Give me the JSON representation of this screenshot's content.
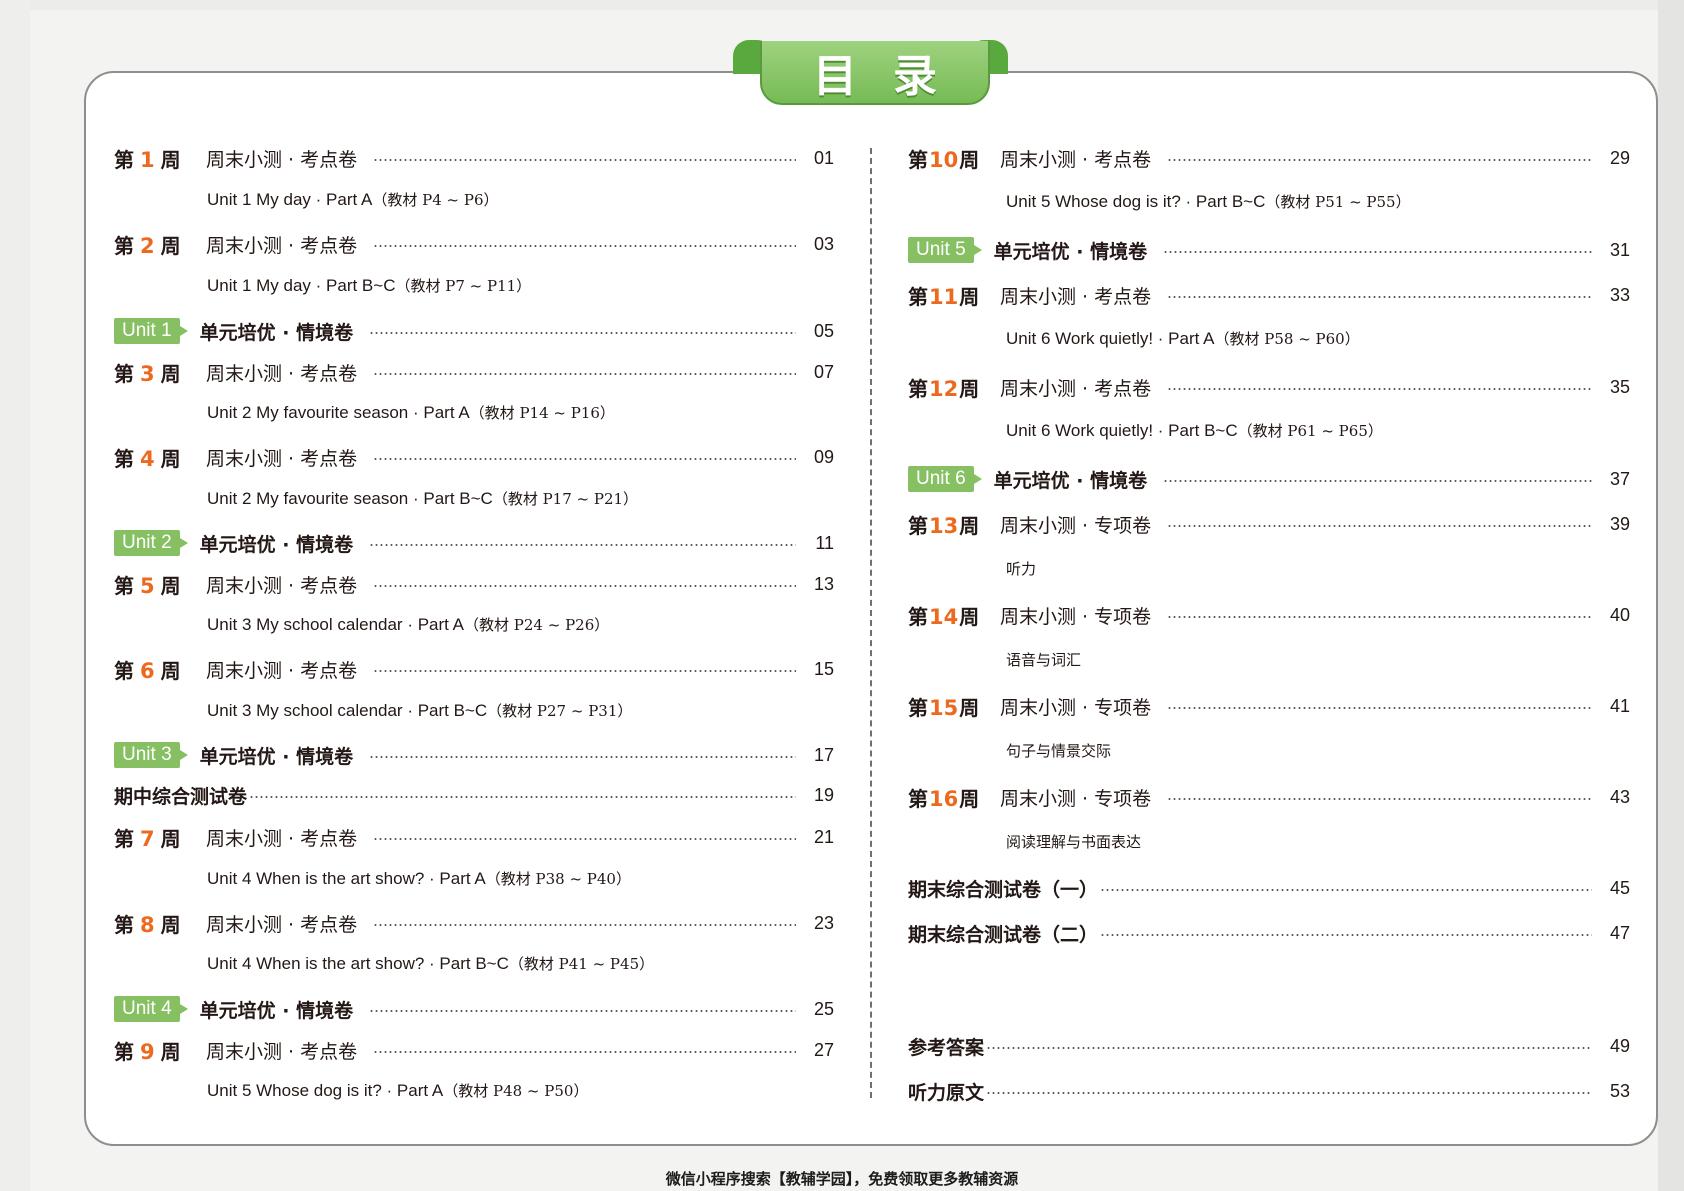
{
  "title": "目录",
  "left": {
    "w1": {
      "prefix": "第",
      "num": "1",
      "suffix": "周",
      "label": "周末小测 · 考点卷",
      "page": "01",
      "sub_main": "Unit 1  My day · Part A",
      "sub_src": "（教材 P4 ~ P6）"
    },
    "w2": {
      "prefix": "第",
      "num": "2",
      "suffix": "周",
      "label": "周末小测 · 考点卷",
      "page": "03",
      "sub_main": "Unit 1  My day · Part B~C",
      "sub_src": "（教材 P7 ~ P11）"
    },
    "u1": {
      "badge": "Unit 1",
      "label": "单元培优 · 情境卷",
      "page": "05"
    },
    "w3": {
      "prefix": "第",
      "num": "3",
      "suffix": "周",
      "label": "周末小测 · 考点卷",
      "page": "07",
      "sub_main": "Unit 2  My favourite season · Part A",
      "sub_src": "（教材 P14 ~ P16）"
    },
    "w4": {
      "prefix": "第",
      "num": "4",
      "suffix": "周",
      "label": "周末小测 · 考点卷",
      "page": "09",
      "sub_main": "Unit 2  My favourite season · Part B~C",
      "sub_src": "（教材 P17 ~ P21）"
    },
    "u2": {
      "badge": "Unit 2",
      "label": "单元培优 · 情境卷",
      "page": "11"
    },
    "w5": {
      "prefix": "第",
      "num": "5",
      "suffix": "周",
      "label": "周末小测 · 考点卷",
      "page": "13",
      "sub_main": "Unit 3  My school calendar · Part A",
      "sub_src": "（教材 P24 ~ P26）"
    },
    "w6": {
      "prefix": "第",
      "num": "6",
      "suffix": "周",
      "label": "周末小测 · 考点卷",
      "page": "15",
      "sub_main": "Unit 3  My school calendar · Part B~C",
      "sub_src": "（教材 P27 ~ P31）"
    },
    "u3": {
      "badge": "Unit 3",
      "label": "单元培优 · 情境卷",
      "page": "17"
    },
    "midterm": {
      "label": "期中综合测试卷",
      "page": "19"
    },
    "w7": {
      "prefix": "第",
      "num": "7",
      "suffix": "周",
      "label": "周末小测 · 考点卷",
      "page": "21",
      "sub_main": "Unit 4  When is the art show? · Part A",
      "sub_src": "（教材 P38 ~ P40）"
    },
    "w8": {
      "prefix": "第",
      "num": "8",
      "suffix": "周",
      "label": "周末小测 · 考点卷",
      "page": "23",
      "sub_main": "Unit 4  When is the art show? · Part B~C",
      "sub_src": "（教材 P41 ~ P45）"
    },
    "u4": {
      "badge": "Unit 4",
      "label": "单元培优 · 情境卷",
      "page": "25"
    },
    "w9": {
      "prefix": "第",
      "num": "9",
      "suffix": "周",
      "label": "周末小测 · 考点卷",
      "page": "27",
      "sub_main": "Unit 5  Whose dog is it? · Part A",
      "sub_src": "（教材 P48 ~ P50）"
    }
  },
  "right": {
    "w10": {
      "prefix": "第",
      "num": "10",
      "suffix": "周",
      "label": "周末小测 · 考点卷",
      "page": "29",
      "sub_main": "Unit 5  Whose dog is it? · Part B~C",
      "sub_src": "（教材 P51 ~ P55）"
    },
    "u5": {
      "badge": "Unit 5",
      "label": "单元培优 · 情境卷",
      "page": "31"
    },
    "w11": {
      "prefix": "第",
      "num": "11",
      "suffix": "周",
      "label": "周末小测 · 考点卷",
      "page": "33",
      "sub_main": "Unit 6  Work quietly! · Part A",
      "sub_src": "（教材 P58 ~ P60）"
    },
    "w12": {
      "prefix": "第",
      "num": "12",
      "suffix": "周",
      "label": "周末小测 · 考点卷",
      "page": "35",
      "sub_main": "Unit 6  Work quietly! · Part B~C",
      "sub_src": "（教材 P61 ~ P65）"
    },
    "u6": {
      "badge": "Unit 6",
      "label": "单元培优 · 情境卷",
      "page": "37"
    },
    "w13": {
      "prefix": "第",
      "num": "13",
      "suffix": "周",
      "label": "周末小测 · 专项卷",
      "page": "39",
      "sub": "听力"
    },
    "w14": {
      "prefix": "第",
      "num": "14",
      "suffix": "周",
      "label": "周末小测 · 专项卷",
      "page": "40",
      "sub": "语音与词汇"
    },
    "w15": {
      "prefix": "第",
      "num": "15",
      "suffix": "周",
      "label": "周末小测 · 专项卷",
      "page": "41",
      "sub": "句子与情景交际"
    },
    "w16": {
      "prefix": "第",
      "num": "16",
      "suffix": "周",
      "label": "周末小测 · 专项卷",
      "page": "43",
      "sub": "阅读理解与书面表达"
    },
    "final1": {
      "label": "期末综合测试卷（一）",
      "page": "45"
    },
    "final2": {
      "label": "期末综合测试卷（二）",
      "page": "47"
    },
    "answers": {
      "label": "参考答案",
      "page": "49"
    },
    "transcript": {
      "label": "听力原文",
      "page": "53"
    }
  },
  "footer": "微信小程序搜索【教辅学园】，免费领取更多教辅资源",
  "colors": {
    "accent_green": "#86c063",
    "week_number_orange": "#ec6a1f",
    "title_green": "#76bb55"
  }
}
